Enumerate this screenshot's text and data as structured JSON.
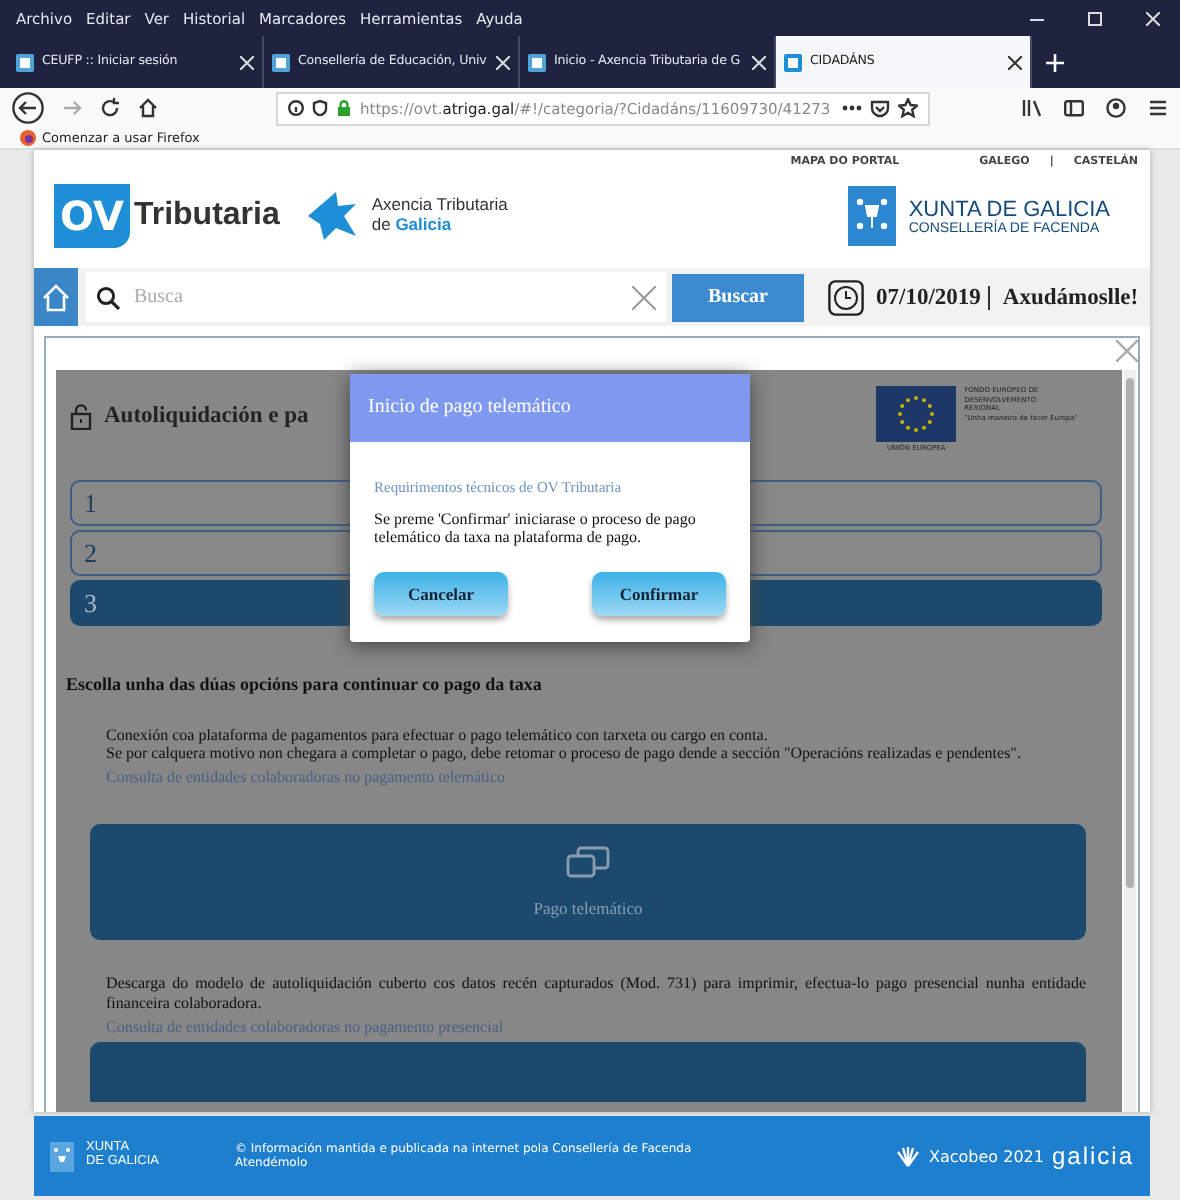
{
  "browser": {
    "menu": [
      "Archivo",
      "Editar",
      "Ver",
      "Historial",
      "Marcadores",
      "Herramientas",
      "Ayuda"
    ],
    "tabs": [
      {
        "title": "CEUFP :: Iniciar sesión",
        "selected": false
      },
      {
        "title": "Consellería de Educación, Univ",
        "selected": false
      },
      {
        "title": "Inicio - Axencia Tributaria de G",
        "selected": false
      },
      {
        "title": "CIDADÁNS",
        "selected": true
      }
    ],
    "url": "https://ovt.**atriga.gal**/#!/categoria/?Cidadáns/11609730/41273",
    "bookmark": "Comenzar a usar Firefox"
  },
  "header": {
    "top_links": [
      "MAPA DO PORTAL",
      "GALEGO",
      "|",
      "CASTELÁN"
    ],
    "logo_badge": "OV",
    "logo_word": "Tributaria",
    "agency": [
      "Axencia Tributaria",
      "de **Galicia**"
    ],
    "xunta": [
      "XUNTA DE GALICIA",
      "CONSELLERÍA DE FACENDA"
    ]
  },
  "search": {
    "placeholder": "Busca",
    "button": "Buscar",
    "date": "07/10/2019",
    "help": "Axudámoslle!"
  },
  "modal": {
    "eu": [
      "FONDO EUROPEO DE",
      "DESENVOLVEMENTO",
      "REXIONAL",
      "\"Unha maneira de facer Europa\""
    ],
    "eu_caption": "UNIÓN EUROPEA",
    "title": "Autoliquidación e pa",
    "steps": [
      {
        "label": "1",
        "selected": false
      },
      {
        "label": "2",
        "selected": false
      },
      {
        "label": "3",
        "selected": true
      }
    ],
    "heading": "Escolla unha das dúas opcións para continuar co pago da taxa",
    "option1": [
      "Conexión coa plataforma de pagamentos para efectuar o pago telemático con tarxeta ou cargo en conta.",
      "Se por calquera motivo non chegara a completar o pago, debe retomar o proceso de pago dende a sección \"Operacións realizadas e pendentes\"."
    ],
    "link1": "Consulta de entidades colaboradoras no pagamento telemático",
    "pay_button": "Pago telemático",
    "option2": [
      "Descarga do modelo de autoliquidación cuberto cos datos recén capturados (Mod. 731) para imprimir, efectua-lo pago presencial nunha entidade financeira colaboradora."
    ],
    "link2": "Consulta de entidades colaboradoras no pagamento presencial"
  },
  "dialog": {
    "title": "Inicio de pago telemático",
    "link": "Requirimentos técnicos de OV Tributaria",
    "message": "Se preme 'Confirmar' iniciarase o proceso de pago telemático da taxa na plataforma de pago.",
    "buttons": [
      "Cancelar",
      "Confirmar"
    ]
  },
  "footer": {
    "xunta": [
      "XUNTA",
      "DE GALICIA"
    ],
    "info": [
      "© Información mantida e publicada na internet pola Consellería de Facenda",
      "Atendémolo"
    ],
    "xacobeo": "Xacobeo 2021",
    "galicia": "galicia"
  }
}
